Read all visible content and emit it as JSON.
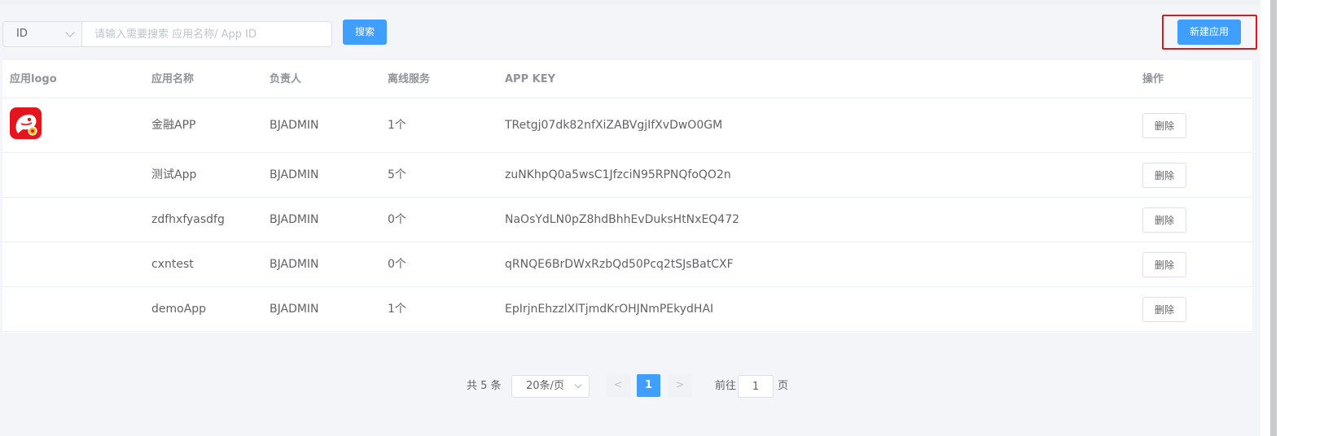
{
  "toolbar": {
    "filter_select": "ID",
    "search_placeholder": "请输入需要搜索 应用名称/ App ID",
    "search_button": "搜索",
    "new_button": "新建应用"
  },
  "table": {
    "headers": {
      "logo": "应用logo",
      "name": "应用名称",
      "owner": "负责人",
      "services": "离线服务",
      "key": "APP KEY",
      "actions": "操作"
    },
    "rows": [
      {
        "name": "金融APP",
        "owner": "BJADMIN",
        "services": "1个",
        "key": "TRetgj07dk82nfXiZABVgjIfXvDwO0GM",
        "action": "删除",
        "has_logo": true
      },
      {
        "name": "测试App",
        "owner": "BJADMIN",
        "services": "5个",
        "key": "zuNKhpQ0a5wsC1JfzciN95RPNQfoQO2n",
        "action": "删除"
      },
      {
        "name": "zdfhxfyasdfg",
        "owner": "BJADMIN",
        "services": "0个",
        "key": "NaOsYdLN0pZ8hdBhhEvDuksHtNxEQ472",
        "action": "删除"
      },
      {
        "name": "cxntest",
        "owner": "BJADMIN",
        "services": "0个",
        "key": "qRNQE6BrDWxRzbQd50Pcq2tSJsBatCXF",
        "action": "删除"
      },
      {
        "name": "demoApp",
        "owner": "BJADMIN",
        "services": "1个",
        "key": "EpIrjnEhzzlXlTjmdKrOHJNmPEkydHAI",
        "action": "删除"
      }
    ]
  },
  "pagination": {
    "total": "共 5 条",
    "page_size": "20条/页",
    "prev": "<",
    "current_page": "1",
    "next": ">",
    "goto_label": "前往",
    "goto_value": "1",
    "page_unit": "页"
  },
  "colors": {
    "primary": "#409eff",
    "highlight": "#e0171b",
    "logo_red": "#e3161d"
  }
}
